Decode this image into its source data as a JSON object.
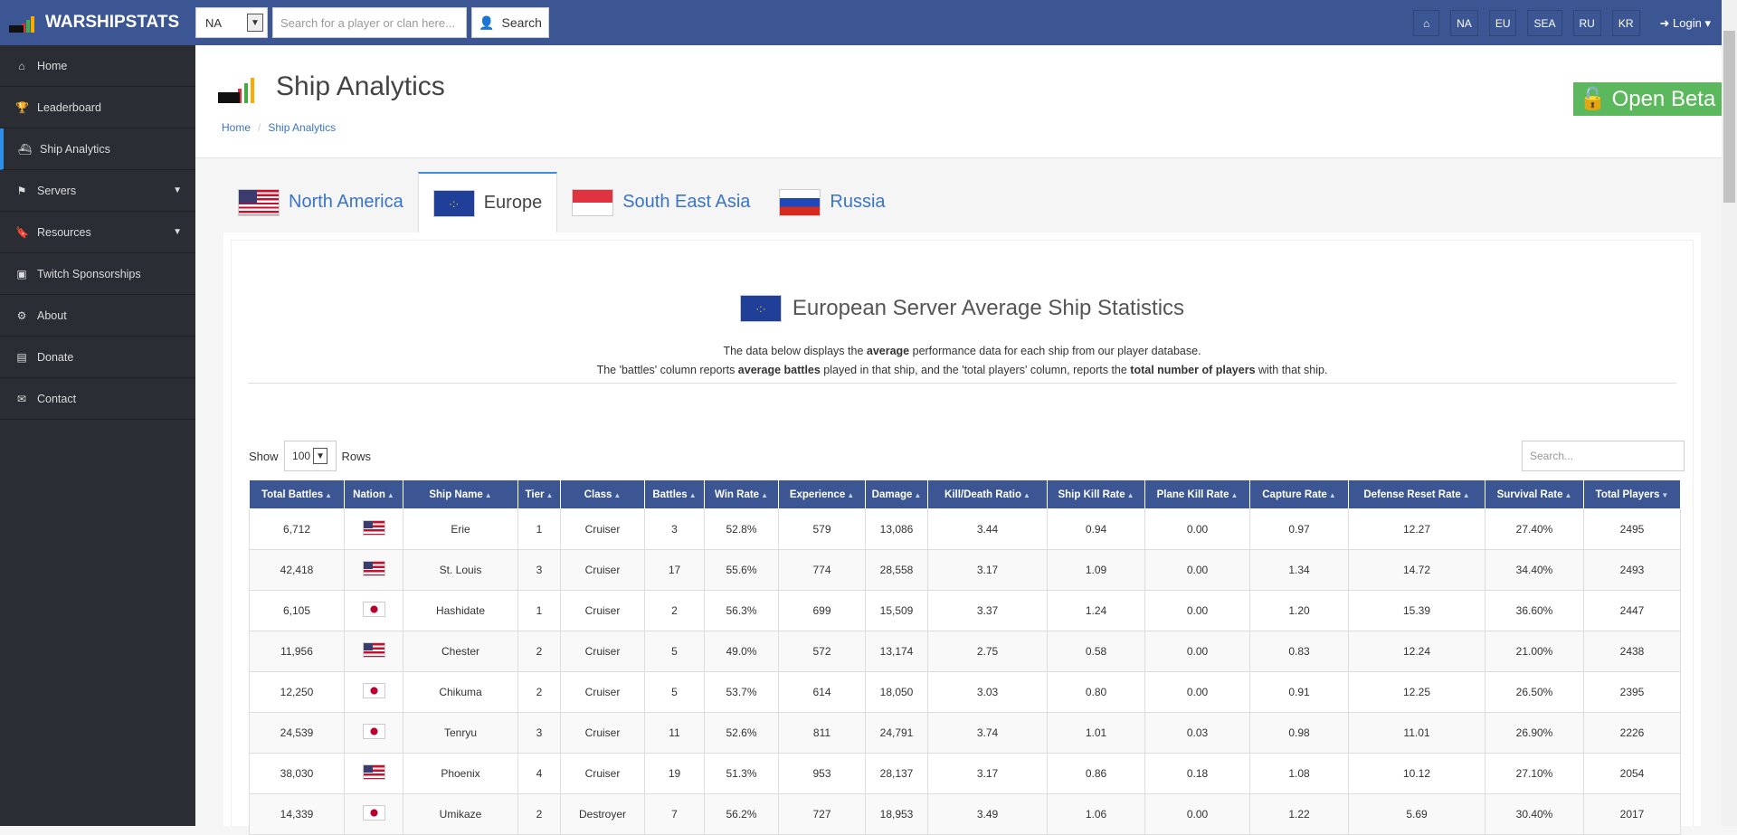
{
  "topbar": {
    "brand": "WARSHIPSTATS",
    "region_select": "NA",
    "search_placeholder": "Search for a player or clan here...",
    "search_button": "Search",
    "nav": [
      "NA",
      "EU",
      "SEA",
      "RU",
      "KR"
    ],
    "login": "Login"
  },
  "sidebar": {
    "items": [
      {
        "label": "Home",
        "icon": "home-icon"
      },
      {
        "label": "Leaderboard",
        "icon": "trophy-icon"
      },
      {
        "label": "Ship Analytics",
        "icon": "ship-icon",
        "active": true
      },
      {
        "label": "Servers",
        "icon": "flag-icon",
        "caret": true
      },
      {
        "label": "Resources",
        "icon": "bookmark-icon",
        "caret": true
      },
      {
        "label": "Twitch Sponsorships",
        "icon": "twitch-icon"
      },
      {
        "label": "About",
        "icon": "cogs-icon"
      },
      {
        "label": "Donate",
        "icon": "money-icon"
      },
      {
        "label": "Contact",
        "icon": "envelope-icon"
      }
    ]
  },
  "header": {
    "title": "Ship Analytics",
    "breadcrumb": [
      "Home",
      "Ship Analytics"
    ],
    "beta": "Open Beta",
    "beta_color": "#5cb85c"
  },
  "tabs": [
    {
      "label": "North America",
      "flag": "us"
    },
    {
      "label": "Europe",
      "flag": "eu",
      "active": true
    },
    {
      "label": "South East Asia",
      "flag": "sg"
    },
    {
      "label": "Russia",
      "flag": "ru"
    }
  ],
  "content": {
    "title": "European Server Average Ship Statistics",
    "desc1": [
      "The data below displays the ",
      "average",
      " performance data for each ship from our player database."
    ],
    "desc2": [
      "The 'battles' column reports ",
      "average battles",
      " played in that ship, and the 'total players' column, reports the ",
      "total number of players",
      " with that ship."
    ],
    "show": "Show",
    "rows_value": "100",
    "rows": "Rows",
    "search_placeholder": "Search..."
  },
  "table": {
    "columns": [
      "Total Battles",
      "Nation",
      "Ship Name",
      "Tier",
      "Class",
      "Battles",
      "Win Rate",
      "Experience",
      "Damage",
      "Kill/Death Ratio",
      "Ship Kill Rate",
      "Plane Kill Rate",
      "Capture Rate",
      "Defense Reset Rate",
      "Survival Rate",
      "Total Players"
    ],
    "rows": [
      [
        "6,712",
        "us",
        "Erie",
        "1",
        "Cruiser",
        "3",
        "52.8%",
        "579",
        "13,086",
        "3.44",
        "0.94",
        "0.00",
        "0.97",
        "12.27",
        "27.40%",
        "2495"
      ],
      [
        "42,418",
        "us",
        "St. Louis",
        "3",
        "Cruiser",
        "17",
        "55.6%",
        "774",
        "28,558",
        "3.17",
        "1.09",
        "0.00",
        "1.34",
        "14.72",
        "34.40%",
        "2493"
      ],
      [
        "6,105",
        "jp",
        "Hashidate",
        "1",
        "Cruiser",
        "2",
        "56.3%",
        "699",
        "15,509",
        "3.37",
        "1.24",
        "0.00",
        "1.20",
        "15.39",
        "36.60%",
        "2447"
      ],
      [
        "11,956",
        "us",
        "Chester",
        "2",
        "Cruiser",
        "5",
        "49.0%",
        "572",
        "13,174",
        "2.75",
        "0.58",
        "0.00",
        "0.83",
        "12.24",
        "21.00%",
        "2438"
      ],
      [
        "12,250",
        "jp",
        "Chikuma",
        "2",
        "Cruiser",
        "5",
        "53.7%",
        "614",
        "18,050",
        "3.03",
        "0.80",
        "0.00",
        "0.91",
        "12.25",
        "26.50%",
        "2395"
      ],
      [
        "24,539",
        "jp",
        "Tenryu",
        "3",
        "Cruiser",
        "11",
        "52.6%",
        "811",
        "24,791",
        "3.74",
        "1.01",
        "0.03",
        "0.98",
        "11.01",
        "26.90%",
        "2226"
      ],
      [
        "38,030",
        "us",
        "Phoenix",
        "4",
        "Cruiser",
        "19",
        "51.3%",
        "953",
        "28,137",
        "3.17",
        "0.86",
        "0.18",
        "1.08",
        "10.12",
        "27.10%",
        "2054"
      ],
      [
        "14,339",
        "jp",
        "Umikaze",
        "2",
        "Destroyer",
        "7",
        "56.2%",
        "727",
        "18,953",
        "3.49",
        "1.06",
        "0.00",
        "1.22",
        "5.69",
        "30.40%",
        "2017"
      ]
    ]
  }
}
